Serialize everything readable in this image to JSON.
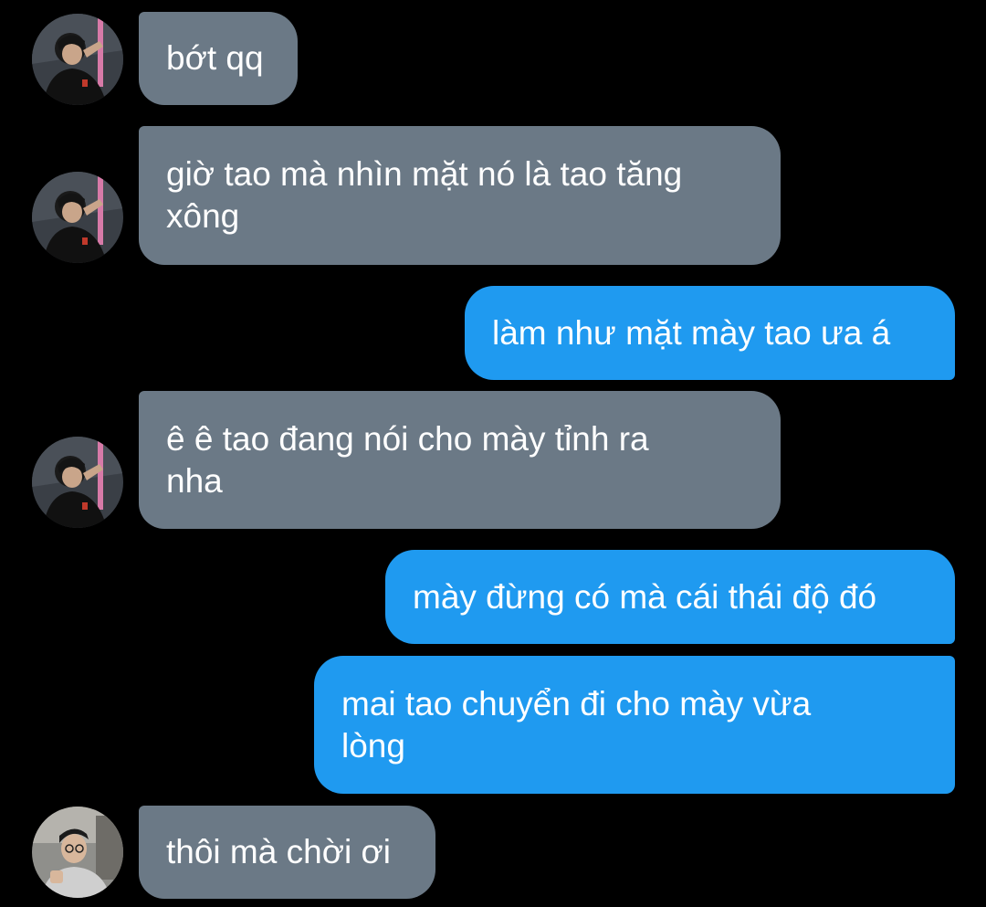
{
  "conversation": {
    "messages": [
      {
        "sender": "them",
        "text": "bớt qq"
      },
      {
        "sender": "them",
        "text": "giờ tao mà nhìn mặt nó là tao tăng\nxông"
      },
      {
        "sender": "me",
        "text": "làm như mặt mày tao ưa á"
      },
      {
        "sender": "them",
        "text": "ê ê tao đang nói cho mày tỉnh ra\nnha"
      },
      {
        "sender": "me",
        "text": "mày đừng có mà cái thái độ đó"
      },
      {
        "sender": "me",
        "text": "mai tao chuyển đi cho mày vừa\nlòng"
      },
      {
        "sender": "them2",
        "text": "thôi mà chời ơi"
      }
    ]
  },
  "colors": {
    "background": "#000000",
    "incoming_bubble": "#6b7986",
    "outgoing_bubble": "#1f9af0",
    "text": "#ffffff"
  },
  "icons": {
    "avatar_them": "profile-photo-avatar",
    "avatar_them2": "profile-photo-avatar"
  }
}
